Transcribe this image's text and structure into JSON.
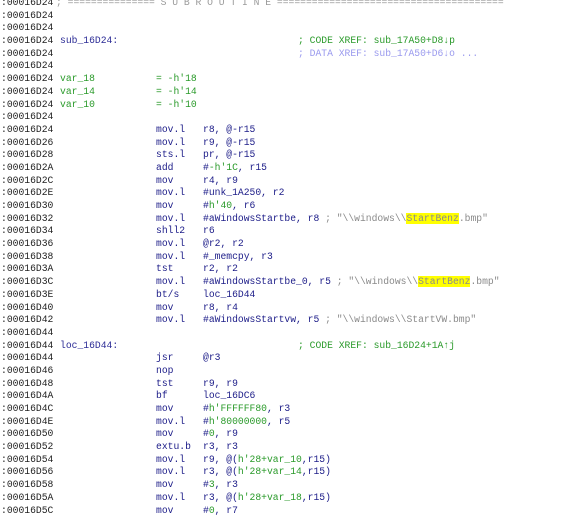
{
  "colors": {
    "label": "#2c2c96",
    "mnemonic": "#1c1c88",
    "comment": "#2a9a2a",
    "data_xref": "#9a9aee",
    "string": "#8a8a8a",
    "highlight": "#ffff00"
  },
  "lines": [
    {
      "addr": ":00016D24",
      "sep": "; =============== S U B R O U T I N E ======================================="
    },
    {
      "addr": ":00016D24"
    },
    {
      "addr": ":00016D24"
    },
    {
      "addr": ":00016D24",
      "label": "sub_16D24:",
      "cmt": [
        {
          "t": "; CODE XREF: sub_17A50+D8↓p",
          "k": "c-code"
        }
      ]
    },
    {
      "addr": ":00016D24",
      "cmt": [
        {
          "t": "; DATA XREF: sub_17A50+D6↓o ...",
          "k": "c-data"
        }
      ]
    },
    {
      "addr": ":00016D24"
    },
    {
      "addr": ":00016D24",
      "var": "var_18",
      "mnem": "= -h'18",
      "varline": true
    },
    {
      "addr": ":00016D24",
      "var": "var_14",
      "mnem": "= -h'14",
      "varline": true
    },
    {
      "addr": ":00016D24",
      "var": "var_10",
      "mnem": "= -h'10",
      "varline": true
    },
    {
      "addr": ":00016D24"
    },
    {
      "addr": ":00016D24",
      "mnem": "mov.l",
      "ops": [
        {
          "t": "r8, @-r15",
          "k": "k-reg"
        }
      ]
    },
    {
      "addr": ":00016D26",
      "mnem": "mov.l",
      "ops": [
        {
          "t": "r9, @-r15",
          "k": "k-reg"
        }
      ]
    },
    {
      "addr": ":00016D28",
      "mnem": "sts.l",
      "ops": [
        {
          "t": "pr, @-r15",
          "k": "k-reg"
        }
      ]
    },
    {
      "addr": ":00016D2A",
      "mnem": "add",
      "ops": [
        {
          "t": "#",
          "k": "k-reg"
        },
        {
          "t": "-h'1C",
          "k": "k-num"
        },
        {
          "t": ", r15",
          "k": "k-reg"
        }
      ]
    },
    {
      "addr": ":00016D2C",
      "mnem": "mov",
      "ops": [
        {
          "t": "r4, r9",
          "k": "k-reg"
        }
      ]
    },
    {
      "addr": ":00016D2E",
      "mnem": "mov.l",
      "ops": [
        {
          "t": "#unk_1A250, r2",
          "k": "k-reg"
        }
      ]
    },
    {
      "addr": ":00016D30",
      "mnem": "mov",
      "ops": [
        {
          "t": "#",
          "k": "k-reg"
        },
        {
          "t": "h'40",
          "k": "k-num"
        },
        {
          "t": ", r6",
          "k": "k-reg"
        }
      ]
    },
    {
      "addr": ":00016D32",
      "mnem": "mov.l",
      "ops": [
        {
          "t": "#aWindowsStartbe, r8 ",
          "k": "k-reg"
        },
        {
          "t": "; \"\\\\windows\\\\",
          "k": "k-str"
        },
        {
          "t": "StartBenz",
          "k": "k-hl"
        },
        {
          "t": ".bmp\"",
          "k": "k-str"
        }
      ]
    },
    {
      "addr": ":00016D34",
      "mnem": "shll2",
      "ops": [
        {
          "t": "r6",
          "k": "k-reg"
        }
      ]
    },
    {
      "addr": ":00016D36",
      "mnem": "mov.l",
      "ops": [
        {
          "t": "@r2, r2",
          "k": "k-reg"
        }
      ]
    },
    {
      "addr": ":00016D38",
      "mnem": "mov.l",
      "ops": [
        {
          "t": "#_memcpy, r3",
          "k": "k-reg"
        }
      ]
    },
    {
      "addr": ":00016D3A",
      "mnem": "tst",
      "ops": [
        {
          "t": "r2, r2",
          "k": "k-reg"
        }
      ]
    },
    {
      "addr": ":00016D3C",
      "mnem": "mov.l",
      "ops": [
        {
          "t": "#aWindowsStartbe_0, r5 ",
          "k": "k-reg"
        },
        {
          "t": "; \"\\\\windows\\\\",
          "k": "k-str"
        },
        {
          "t": "StartBenz",
          "k": "k-hl"
        },
        {
          "t": ".bmp\"",
          "k": "k-str"
        }
      ]
    },
    {
      "addr": ":00016D3E",
      "mnem": "bt/s",
      "ops": [
        {
          "t": "loc_16D44",
          "k": "k-reg"
        }
      ]
    },
    {
      "addr": ":00016D40",
      "mnem": "mov",
      "ops": [
        {
          "t": "r8, r4",
          "k": "k-reg"
        }
      ]
    },
    {
      "addr": ":00016D42",
      "mnem": "mov.l",
      "ops": [
        {
          "t": "#aWindowsStartvw, r5 ",
          "k": "k-reg"
        },
        {
          "t": "; \"\\\\windows\\\\StartVW.bmp\"",
          "k": "k-str"
        }
      ]
    },
    {
      "addr": ":00016D44"
    },
    {
      "addr": ":00016D44",
      "label": "loc_16D44:",
      "cmt": [
        {
          "t": "; CODE XREF: sub_16D24+1A↑j",
          "k": "c-code"
        }
      ]
    },
    {
      "addr": ":00016D44",
      "mnem": "jsr",
      "ops": [
        {
          "t": "@r3",
          "k": "k-reg"
        }
      ]
    },
    {
      "addr": ":00016D46",
      "mnem": "nop"
    },
    {
      "addr": ":00016D48",
      "mnem": "tst",
      "ops": [
        {
          "t": "r9, r9",
          "k": "k-reg"
        }
      ]
    },
    {
      "addr": ":00016D4A",
      "mnem": "bf",
      "ops": [
        {
          "t": "loc_16DC6",
          "k": "k-reg"
        }
      ]
    },
    {
      "addr": ":00016D4C",
      "mnem": "mov",
      "ops": [
        {
          "t": "#",
          "k": "k-reg"
        },
        {
          "t": "h'FFFFFF80",
          "k": "k-num"
        },
        {
          "t": ", r3",
          "k": "k-reg"
        }
      ]
    },
    {
      "addr": ":00016D4E",
      "mnem": "mov.l",
      "ops": [
        {
          "t": "#",
          "k": "k-reg"
        },
        {
          "t": "h'80000000",
          "k": "k-num"
        },
        {
          "t": ", r5",
          "k": "k-reg"
        }
      ]
    },
    {
      "addr": ":00016D50",
      "mnem": "mov",
      "ops": [
        {
          "t": "#",
          "k": "k-reg"
        },
        {
          "t": "0",
          "k": "k-num"
        },
        {
          "t": ", r9",
          "k": "k-reg"
        }
      ]
    },
    {
      "addr": ":00016D52",
      "mnem": "extu.b",
      "ops": [
        {
          "t": "r3, r3",
          "k": "k-reg"
        }
      ]
    },
    {
      "addr": ":00016D54",
      "mnem": "mov.l",
      "ops": [
        {
          "t": "r9, @(",
          "k": "k-reg"
        },
        {
          "t": "h'28+var_10",
          "k": "k-num"
        },
        {
          "t": ",r15)",
          "k": "k-reg"
        }
      ]
    },
    {
      "addr": ":00016D56",
      "mnem": "mov.l",
      "ops": [
        {
          "t": "r3, @(",
          "k": "k-reg"
        },
        {
          "t": "h'28+var_14",
          "k": "k-num"
        },
        {
          "t": ",r15)",
          "k": "k-reg"
        }
      ]
    },
    {
      "addr": ":00016D58",
      "mnem": "mov",
      "ops": [
        {
          "t": "#",
          "k": "k-reg"
        },
        {
          "t": "3",
          "k": "k-num"
        },
        {
          "t": ", r3",
          "k": "k-reg"
        }
      ]
    },
    {
      "addr": ":00016D5A",
      "mnem": "mov.l",
      "ops": [
        {
          "t": "r3, @(",
          "k": "k-reg"
        },
        {
          "t": "h'28+var_18",
          "k": "k-num"
        },
        {
          "t": ",r15)",
          "k": "k-reg"
        }
      ]
    },
    {
      "addr": ":00016D5C",
      "mnem": "mov",
      "ops": [
        {
          "t": "#",
          "k": "k-reg"
        },
        {
          "t": "0",
          "k": "k-num"
        },
        {
          "t": ", r7",
          "k": "k-reg"
        }
      ]
    }
  ]
}
